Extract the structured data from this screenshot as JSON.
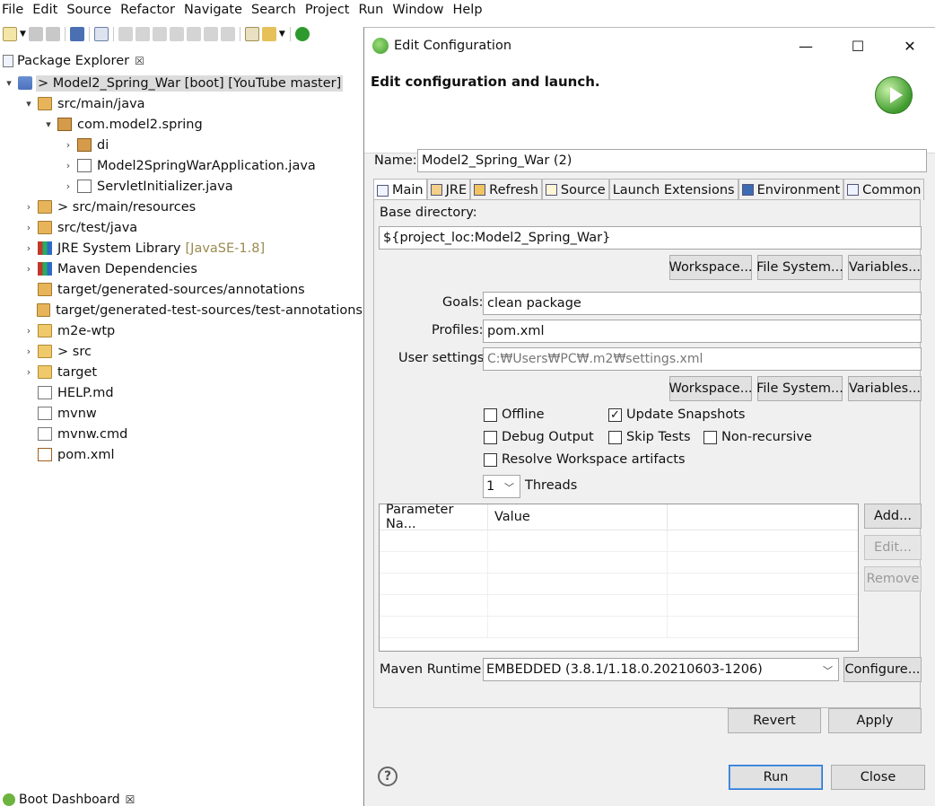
{
  "menu": [
    "File",
    "Edit",
    "Source",
    "Refactor",
    "Navigate",
    "Search",
    "Project",
    "Run",
    "Window",
    "Help"
  ],
  "explorer": {
    "tab_label": "Package Explorer",
    "tab_close": "☒",
    "tree": [
      {
        "indent": 0,
        "twisty": "▾",
        "icon": "project-icon",
        "label": "> Model2_Spring_War [boot] [YouTube master]",
        "selected": true
      },
      {
        "indent": 1,
        "twisty": "▾",
        "icon": "source-folder-icon",
        "label": "src/main/java"
      },
      {
        "indent": 2,
        "twisty": "▾",
        "icon": "package-icon",
        "label": "com.model2.spring"
      },
      {
        "indent": 3,
        "twisty": "›",
        "icon": "package-icon",
        "label": "di"
      },
      {
        "indent": 3,
        "twisty": "›",
        "icon": "java-file-icon",
        "label": "Model2SpringWarApplication.java"
      },
      {
        "indent": 3,
        "twisty": "›",
        "icon": "java-file-icon",
        "label": "ServletInitializer.java"
      },
      {
        "indent": 1,
        "twisty": "›",
        "icon": "source-folder-icon",
        "label": "> src/main/resources"
      },
      {
        "indent": 1,
        "twisty": "›",
        "icon": "source-folder-icon",
        "label": "src/test/java"
      },
      {
        "indent": 1,
        "twisty": "›",
        "icon": "library-icon",
        "label": "JRE System Library",
        "deco": "[JavaSE-1.8]"
      },
      {
        "indent": 1,
        "twisty": "›",
        "icon": "library-icon",
        "label": "Maven Dependencies"
      },
      {
        "indent": 1,
        "twisty": "",
        "icon": "source-folder-icon",
        "label": "target/generated-sources/annotations"
      },
      {
        "indent": 1,
        "twisty": "",
        "icon": "source-folder-icon",
        "label": "target/generated-test-sources/test-annotations"
      },
      {
        "indent": 1,
        "twisty": "›",
        "icon": "folder-icon",
        "label": "m2e-wtp"
      },
      {
        "indent": 1,
        "twisty": "›",
        "icon": "folder-icon",
        "label": "> src"
      },
      {
        "indent": 1,
        "twisty": "›",
        "icon": "folder-icon",
        "label": "target"
      },
      {
        "indent": 1,
        "twisty": "",
        "icon": "file-icon",
        "label": "HELP.md"
      },
      {
        "indent": 1,
        "twisty": "",
        "icon": "file-icon",
        "label": "mvnw"
      },
      {
        "indent": 1,
        "twisty": "",
        "icon": "file-icon",
        "label": "mvnw.cmd"
      },
      {
        "indent": 1,
        "twisty": "",
        "icon": "xml-file-icon",
        "label": "pom.xml"
      }
    ]
  },
  "boot_dashboard": {
    "label": "Boot Dashboard",
    "close": "☒"
  },
  "dialog": {
    "title": "Edit Configuration",
    "header": "Edit configuration and launch.",
    "name_label": "Name:",
    "name_value": "Model2_Spring_War (2)",
    "tabs": [
      {
        "label": "Main",
        "icon": "main-tab-icon",
        "active": true
      },
      {
        "label": "JRE",
        "icon": "jre-tab-icon"
      },
      {
        "label": "Refresh",
        "icon": "refresh-tab-icon"
      },
      {
        "label": "Source",
        "icon": "source-tab-icon"
      },
      {
        "label": "Launch Extensions",
        "icon": ""
      },
      {
        "label": "Environment",
        "icon": "environment-tab-icon"
      },
      {
        "label": "Common",
        "icon": "common-tab-icon"
      }
    ],
    "base_dir_label": "Base directory:",
    "base_dir_value": "${project_loc:Model2_Spring_War}",
    "workspace_btn": "Workspace...",
    "filesystem_btn": "File System...",
    "variables_btn": "Variables...",
    "goals_label": "Goals:",
    "goals_value": "clean package",
    "profiles_label": "Profiles:",
    "profiles_value": "pom.xml",
    "user_settings_label": "User settings:",
    "user_settings_value": "C:₩Users₩PC₩.m2₩settings.xml",
    "checkboxes": {
      "offline": {
        "label": "Offline",
        "checked": false
      },
      "update_snapshots": {
        "label": "Update Snapshots",
        "checked": true
      },
      "debug_output": {
        "label": "Debug Output",
        "checked": false
      },
      "skip_tests": {
        "label": "Skip Tests",
        "checked": false
      },
      "non_recursive": {
        "label": "Non-recursive",
        "checked": false
      },
      "resolve_workspace": {
        "label": "Resolve Workspace artifacts",
        "checked": false
      }
    },
    "threads_value": "1",
    "threads_label": "Threads",
    "param_col_name": "Parameter Na...",
    "param_col_value": "Value",
    "add_btn": "Add...",
    "edit_btn": "Edit...",
    "remove_btn": "Remove",
    "runtime_label": "Maven Runtime:",
    "runtime_value": "EMBEDDED (3.8.1/1.18.0.20210603-1206)",
    "configure_btn": "Configure...",
    "revert_btn": "Revert",
    "apply_btn": "Apply",
    "run_btn": "Run",
    "close_btn": "Close",
    "help_glyph": "?",
    "minimize_glyph": "—",
    "maximize_glyph": "☐",
    "close_glyph": "✕"
  }
}
